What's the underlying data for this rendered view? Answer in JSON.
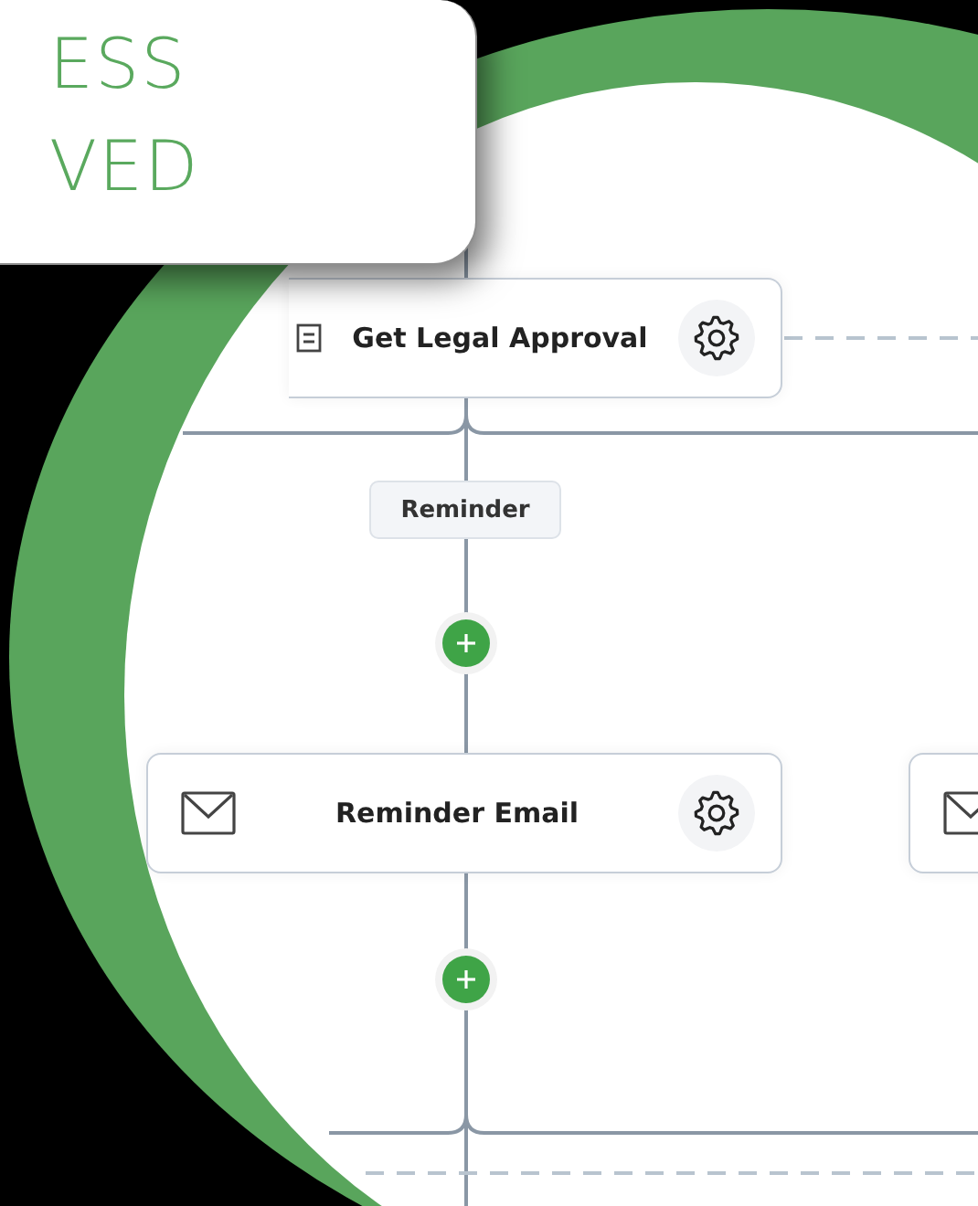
{
  "callout": {
    "lines": [
      "ESS",
      "VED"
    ]
  },
  "flow": {
    "steps": [
      {
        "kind": "approval",
        "label": "Get Legal Approval"
      },
      {
        "kind": "tag",
        "label": "Reminder"
      },
      {
        "kind": "add"
      },
      {
        "kind": "email",
        "label": "Reminder Email"
      },
      {
        "kind": "email_cut"
      },
      {
        "kind": "add"
      }
    ]
  }
}
